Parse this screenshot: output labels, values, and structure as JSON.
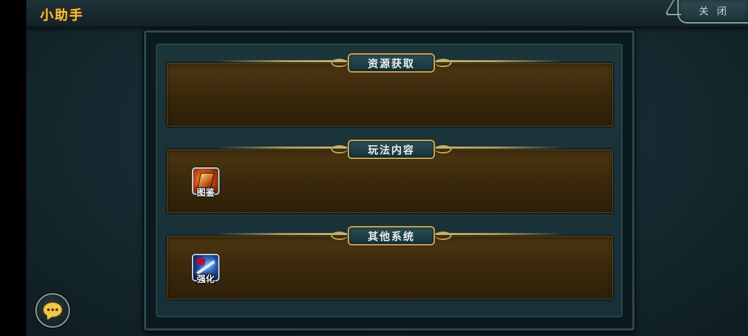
{
  "header": {
    "title": "小助手",
    "close_label": "关闭"
  },
  "sections": [
    {
      "title": "资源获取",
      "items": []
    },
    {
      "title": "玩法内容",
      "items": [
        {
          "label": "图鉴",
          "icon": "book-icon"
        }
      ]
    },
    {
      "title": "其他系统",
      "items": [
        {
          "label": "强化",
          "icon": "sword-icon"
        }
      ]
    }
  ],
  "chat": {
    "icon": "chat-bubble-icon"
  },
  "colors": {
    "title_gold": "#f0c455",
    "section_brown": "#3d2a0c",
    "frame_teal": "#1c353b",
    "plate_border_gold": "#c9a856"
  }
}
